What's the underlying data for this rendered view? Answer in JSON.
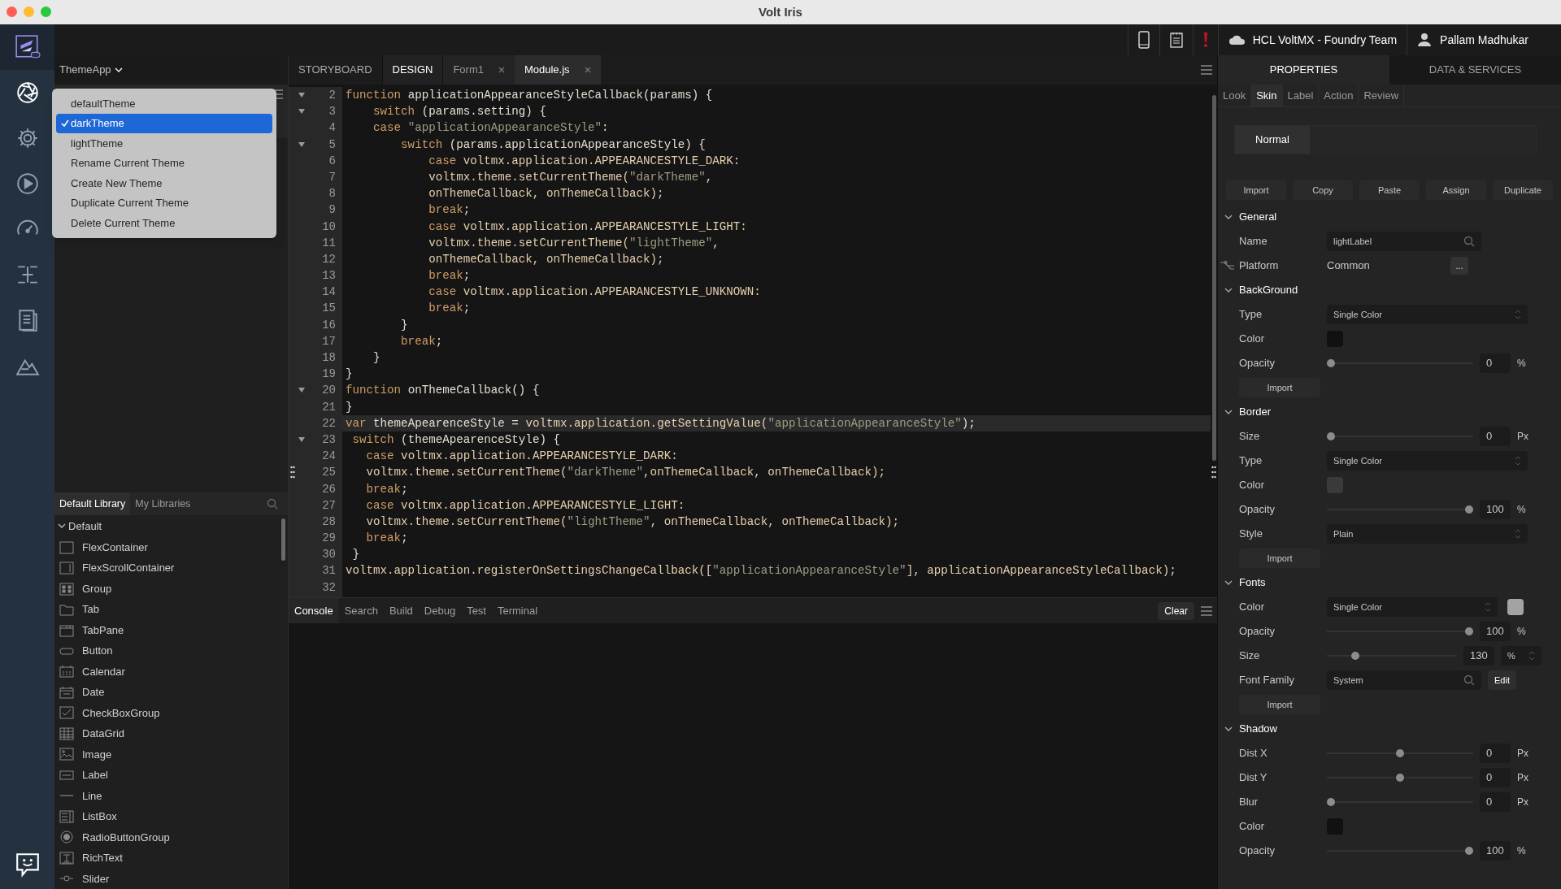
{
  "window": {
    "title": "Volt Iris"
  },
  "rail": [
    {
      "kind": "aperture",
      "selected": true
    },
    {
      "kind": "gear",
      "selected": false
    },
    {
      "kind": "play",
      "selected": false
    },
    {
      "kind": "gauge",
      "selected": false
    },
    {
      "kind": "hierarchy",
      "selected": false
    },
    {
      "kind": "document",
      "selected": false
    },
    {
      "kind": "mountain",
      "selected": false
    }
  ],
  "header": {
    "team": "HCL VoltMX - Foundry Team",
    "user": "Pallam Madhukar"
  },
  "project": {
    "name": "ThemeApp"
  },
  "theme_menu": [
    {
      "label": "defaultTheme",
      "selected": false
    },
    {
      "label": "darkTheme",
      "selected": true
    },
    {
      "label": "lightTheme",
      "selected": false
    },
    {
      "label": "Rename Current Theme",
      "selected": false
    },
    {
      "label": "Create New Theme",
      "selected": false
    },
    {
      "label": "Duplicate Current Theme",
      "selected": false
    },
    {
      "label": "Delete Current Theme",
      "selected": false
    }
  ],
  "library": {
    "tabs": [
      {
        "label": "Default Library",
        "selected": true
      },
      {
        "label": "My Libraries",
        "selected": false
      }
    ],
    "group": "Default",
    "expanded": true,
    "items": [
      {
        "label": "FlexContainer",
        "kind": "container"
      },
      {
        "label": "FlexScrollContainer",
        "kind": "scroll"
      },
      {
        "label": "Group",
        "kind": "group"
      },
      {
        "label": "Tab",
        "kind": "tab"
      },
      {
        "label": "TabPane",
        "kind": "tabpane"
      },
      {
        "label": "Button",
        "kind": "button"
      },
      {
        "label": "Calendar",
        "kind": "calendar"
      },
      {
        "label": "Date",
        "kind": "date"
      },
      {
        "label": "CheckBoxGroup",
        "kind": "checkbox"
      },
      {
        "label": "DataGrid",
        "kind": "datagrid"
      },
      {
        "label": "Image",
        "kind": "image"
      },
      {
        "label": "Label",
        "kind": "label"
      },
      {
        "label": "Line",
        "kind": "line"
      },
      {
        "label": "ListBox",
        "kind": "listbox"
      },
      {
        "label": "RadioButtonGroup",
        "kind": "radio"
      },
      {
        "label": "RichText",
        "kind": "richtext"
      },
      {
        "label": "Slider",
        "kind": "slider"
      }
    ]
  },
  "mode_tabs": [
    {
      "label": "STORYBOARD",
      "selected": false
    },
    {
      "label": "DESIGN",
      "selected": true
    }
  ],
  "file_tabs": [
    {
      "label": "Form1",
      "selected": false
    },
    {
      "label": "Module.js",
      "selected": true
    }
  ],
  "code": [
    {
      "num": "2",
      "fold": true,
      "current": false,
      "tokens": [
        {
          "kind": "kw",
          "text": "function"
        },
        {
          "kind": "pl",
          "text": " applicationAppearanceStyleCallback(params) {"
        }
      ]
    },
    {
      "num": "3",
      "fold": true,
      "current": false,
      "tokens": [
        {
          "kind": "kw",
          "text": "    switch"
        },
        {
          "kind": "pl",
          "text": " (params.setting) {"
        }
      ]
    },
    {
      "num": "4",
      "fold": false,
      "current": false,
      "tokens": [
        {
          "kind": "kw",
          "text": "    case"
        },
        {
          "kind": "str",
          "text": " \"applicationAppearanceStyle\""
        },
        {
          "kind": "pl",
          "text": ":"
        }
      ]
    },
    {
      "num": "5",
      "fold": true,
      "current": false,
      "tokens": [
        {
          "kind": "kw",
          "text": "        switch"
        },
        {
          "kind": "pl",
          "text": " (params.applicationAppearanceStyle) {"
        }
      ]
    },
    {
      "num": "6",
      "fold": false,
      "current": false,
      "tokens": [
        {
          "kind": "kw",
          "text": "            case"
        },
        {
          "kind": "id",
          "text": " voltmx.application.APPEARANCESTYLE_DARK:"
        }
      ]
    },
    {
      "num": "7",
      "fold": false,
      "current": false,
      "tokens": [
        {
          "kind": "id",
          "text": "            voltmx.theme.setCurrentTheme("
        },
        {
          "kind": "str",
          "text": "\"darkTheme\""
        },
        {
          "kind": "pl",
          "text": ","
        }
      ]
    },
    {
      "num": "8",
      "fold": false,
      "current": false,
      "tokens": [
        {
          "kind": "id",
          "text": "            onThemeCallback, onThemeCallback);"
        }
      ]
    },
    {
      "num": "9",
      "fold": false,
      "current": false,
      "tokens": [
        {
          "kind": "kw",
          "text": "            break"
        },
        {
          "kind": "pl",
          "text": ";"
        }
      ]
    },
    {
      "num": "10",
      "fold": false,
      "current": false,
      "tokens": [
        {
          "kind": "kw",
          "text": "            case"
        },
        {
          "kind": "id",
          "text": " voltmx.application.APPEARANCESTYLE_LIGHT:"
        }
      ]
    },
    {
      "num": "11",
      "fold": false,
      "current": false,
      "tokens": [
        {
          "kind": "id",
          "text": "            voltmx.theme.setCurrentTheme("
        },
        {
          "kind": "str",
          "text": "\"lightTheme\""
        },
        {
          "kind": "pl",
          "text": ","
        }
      ]
    },
    {
      "num": "12",
      "fold": false,
      "current": false,
      "tokens": [
        {
          "kind": "id",
          "text": "            onThemeCallback, onThemeCallback);"
        }
      ]
    },
    {
      "num": "13",
      "fold": false,
      "current": false,
      "tokens": [
        {
          "kind": "kw",
          "text": "            break"
        },
        {
          "kind": "pl",
          "text": ";"
        }
      ]
    },
    {
      "num": "14",
      "fold": false,
      "current": false,
      "tokens": [
        {
          "kind": "kw",
          "text": "            case"
        },
        {
          "kind": "id",
          "text": " voltmx.application.APPEARANCESTYLE_UNKNOWN:"
        }
      ]
    },
    {
      "num": "15",
      "fold": false,
      "current": false,
      "tokens": [
        {
          "kind": "kw",
          "text": "            break"
        },
        {
          "kind": "pl",
          "text": ";"
        }
      ]
    },
    {
      "num": "16",
      "fold": false,
      "current": false,
      "tokens": [
        {
          "kind": "pl",
          "text": "        }"
        }
      ]
    },
    {
      "num": "17",
      "fold": false,
      "current": false,
      "tokens": [
        {
          "kind": "kw",
          "text": "        break"
        },
        {
          "kind": "pl",
          "text": ";"
        }
      ]
    },
    {
      "num": "18",
      "fold": false,
      "current": false,
      "tokens": [
        {
          "kind": "pl",
          "text": "    }"
        }
      ]
    },
    {
      "num": "19",
      "fold": false,
      "current": false,
      "tokens": [
        {
          "kind": "pl",
          "text": "}"
        }
      ]
    },
    {
      "num": "20",
      "fold": true,
      "current": false,
      "tokens": [
        {
          "kind": "kw",
          "text": "function"
        },
        {
          "kind": "pl",
          "text": " onThemeCallback() {"
        }
      ]
    },
    {
      "num": "21",
      "fold": false,
      "current": false,
      "tokens": [
        {
          "kind": "pl",
          "text": "}"
        }
      ]
    },
    {
      "num": "22",
      "fold": false,
      "current": true,
      "tokens": [
        {
          "kind": "kw",
          "text": "var"
        },
        {
          "kind": "pl",
          "text": " themeApearenceStyle = "
        },
        {
          "kind": "id",
          "text": "voltmx.application.getSettingValue("
        },
        {
          "kind": "str",
          "text": "\"applicationAppearanceStyle\""
        },
        {
          "kind": "pl",
          "text": ");"
        }
      ]
    },
    {
      "num": "23",
      "fold": true,
      "current": false,
      "tokens": [
        {
          "kind": "kw",
          "text": " switch"
        },
        {
          "kind": "pl",
          "text": " (themeApearenceStyle) {"
        }
      ]
    },
    {
      "num": "24",
      "fold": false,
      "current": false,
      "tokens": [
        {
          "kind": "kw",
          "text": "   case"
        },
        {
          "kind": "id",
          "text": " voltmx.application.APPEARANCESTYLE_DARK:"
        }
      ]
    },
    {
      "num": "25",
      "fold": false,
      "current": false,
      "tokens": [
        {
          "kind": "id",
          "text": "   voltmx.theme.setCurrentTheme("
        },
        {
          "kind": "str",
          "text": "\"darkTheme\""
        },
        {
          "kind": "id",
          "text": ",onThemeCallback, onThemeCallback);"
        }
      ]
    },
    {
      "num": "26",
      "fold": false,
      "current": false,
      "tokens": [
        {
          "kind": "kw",
          "text": "   break"
        },
        {
          "kind": "pl",
          "text": ";"
        }
      ]
    },
    {
      "num": "27",
      "fold": false,
      "current": false,
      "tokens": [
        {
          "kind": "kw",
          "text": "   case"
        },
        {
          "kind": "id",
          "text": " voltmx.application.APPEARANCESTYLE_LIGHT:"
        }
      ]
    },
    {
      "num": "28",
      "fold": false,
      "current": false,
      "tokens": [
        {
          "kind": "id",
          "text": "   voltmx.theme.setCurrentTheme("
        },
        {
          "kind": "str",
          "text": "\"lightTheme\""
        },
        {
          "kind": "id",
          "text": ", onThemeCallback, onThemeCallback);"
        }
      ]
    },
    {
      "num": "29",
      "fold": false,
      "current": false,
      "tokens": [
        {
          "kind": "kw",
          "text": "   break"
        },
        {
          "kind": "pl",
          "text": ";"
        }
      ]
    },
    {
      "num": "30",
      "fold": false,
      "current": false,
      "tokens": [
        {
          "kind": "pl",
          "text": " }"
        }
      ]
    },
    {
      "num": "31",
      "fold": false,
      "current": false,
      "tokens": [
        {
          "kind": "id",
          "text": "voltmx.application.registerOnSettingsChangeCallback(["
        },
        {
          "kind": "str",
          "text": "\"applicationAppearanceStyle\""
        },
        {
          "kind": "id",
          "text": "], applicationAppearanceStyleCallback);"
        }
      ]
    },
    {
      "num": "32",
      "fold": false,
      "current": false
    }
  ],
  "console": {
    "tabs": [
      {
        "label": "Console",
        "selected": true
      },
      {
        "label": "Search",
        "selected": false
      },
      {
        "label": "Build",
        "selected": false
      },
      {
        "label": "Debug",
        "selected": false
      },
      {
        "label": "Test",
        "selected": false
      },
      {
        "label": "Terminal",
        "selected": false
      }
    ],
    "clear": "Clear"
  },
  "properties": {
    "tabs": [
      {
        "label": "PROPERTIES",
        "selected": true
      },
      {
        "label": "DATA & SERVICES",
        "selected": false
      }
    ],
    "subtabs": [
      {
        "label": "Look",
        "selected": false
      },
      {
        "label": "Skin",
        "selected": true
      },
      {
        "label": "Label",
        "selected": false
      },
      {
        "label": "Action",
        "selected": false
      },
      {
        "label": "Review",
        "selected": false
      }
    ],
    "state": "Normal",
    "actions": [
      "Import",
      "Copy",
      "Paste",
      "Assign",
      "Duplicate"
    ],
    "sections": [
      {
        "title": "General",
        "expanded": true,
        "rows": [
          {
            "kind": "search-field",
            "label": "Name",
            "value": "lightLabel"
          },
          {
            "kind": "platform",
            "label": "Platform",
            "value": "Common",
            "button": "..."
          }
        ]
      },
      {
        "title": "BackGround",
        "expanded": true,
        "rows": [
          {
            "kind": "select",
            "label": "Type",
            "value": "Single Color"
          },
          {
            "kind": "swatch",
            "label": "Color",
            "color": "#111111"
          },
          {
            "kind": "slider",
            "label": "Opacity",
            "level": 0,
            "reading": "0",
            "unit": "%"
          },
          {
            "kind": "import",
            "button": "Import"
          }
        ]
      },
      {
        "title": "Border",
        "expanded": true,
        "rows": [
          {
            "kind": "slider",
            "label": "Size",
            "level": 0,
            "reading": "0",
            "unit": "Px"
          },
          {
            "kind": "select",
            "label": "Type",
            "value": "Single Color"
          },
          {
            "kind": "swatch",
            "label": "Color",
            "color": "#3a3a3a"
          },
          {
            "kind": "slider",
            "label": "Opacity",
            "level": 1,
            "reading": "100",
            "unit": "%"
          },
          {
            "kind": "select",
            "label": "Style",
            "value": "Plain"
          },
          {
            "kind": "import",
            "button": "Import"
          }
        ]
      },
      {
        "title": "Fonts",
        "expanded": true,
        "rows": [
          {
            "kind": "select-swatch",
            "label": "Color",
            "value": "Single Color",
            "color": "#a3a3a3"
          },
          {
            "kind": "slider",
            "label": "Opacity",
            "level": 1,
            "reading": "100",
            "unit": "%"
          },
          {
            "kind": "slider-unit",
            "label": "Size",
            "level": 0.2,
            "reading": "130",
            "unit": "%"
          },
          {
            "kind": "search-field-button",
            "label": "Font Family",
            "value": "System",
            "button": "Edit"
          },
          {
            "kind": "import",
            "button": "Import"
          }
        ]
      },
      {
        "title": "Shadow",
        "expanded": true,
        "rows": [
          {
            "kind": "slider",
            "label": "Dist X",
            "level": 0.5,
            "reading": "0",
            "unit": "Px"
          },
          {
            "kind": "slider",
            "label": "Dist Y",
            "level": 0.5,
            "reading": "0",
            "unit": "Px"
          },
          {
            "kind": "slider",
            "label": "Blur",
            "level": 0,
            "reading": "0",
            "unit": "Px"
          },
          {
            "kind": "swatch",
            "label": "Color",
            "color": "#111111"
          },
          {
            "kind": "slider",
            "label": "Opacity",
            "level": 1,
            "reading": "100",
            "unit": "%"
          }
        ]
      }
    ]
  }
}
